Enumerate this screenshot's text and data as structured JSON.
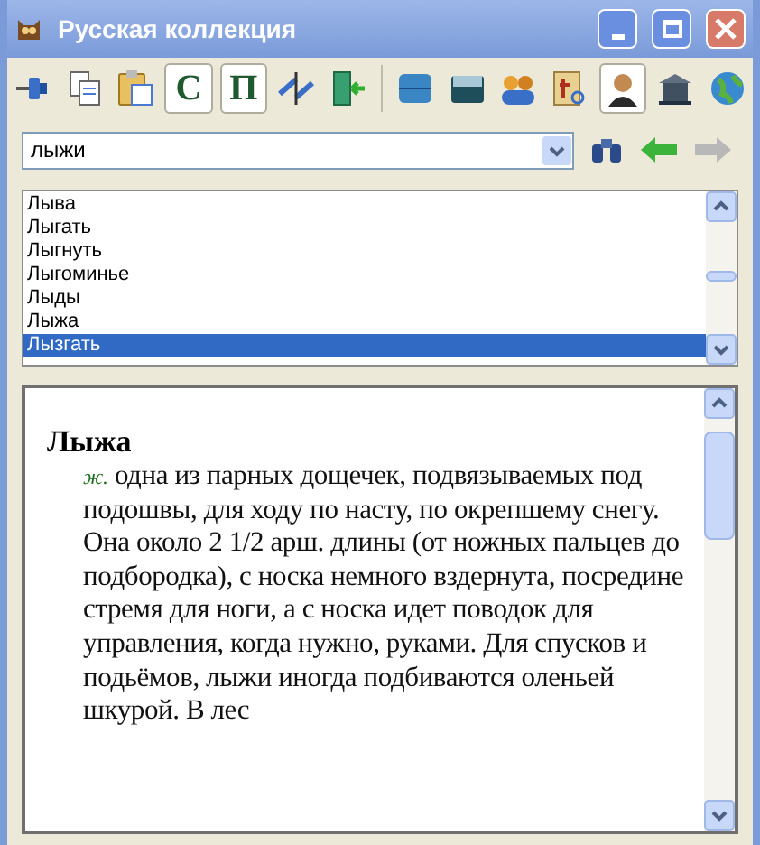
{
  "window": {
    "title": "Русская коллекция"
  },
  "toolbar": [
    {
      "kind": "pin",
      "pressed": false
    },
    {
      "kind": "copy",
      "pressed": false
    },
    {
      "kind": "paste",
      "pressed": false
    },
    {
      "kind": "letter",
      "label": "С",
      "pressed": true
    },
    {
      "kind": "letter",
      "label": "П",
      "pressed": true
    },
    {
      "kind": "swap",
      "pressed": false
    },
    {
      "kind": "exit",
      "pressed": false
    },
    {
      "kind": "separator"
    },
    {
      "kind": "book",
      "pressed": false
    },
    {
      "kind": "box",
      "pressed": false
    },
    {
      "kind": "people",
      "pressed": false
    },
    {
      "kind": "scroll",
      "pressed": false
    },
    {
      "kind": "portrait",
      "pressed": true
    },
    {
      "kind": "museum",
      "pressed": false
    },
    {
      "kind": "globe",
      "pressed": false
    }
  ],
  "search": {
    "value": "лыжи",
    "back_disabled": false,
    "forward_disabled": true
  },
  "word_list": [
    {
      "label": "Лыва",
      "selected": false
    },
    {
      "label": "Лыгать",
      "selected": false
    },
    {
      "label": "Лыгнуть",
      "selected": false
    },
    {
      "label": "Лыгоминье",
      "selected": false
    },
    {
      "label": "Лыды",
      "selected": false
    },
    {
      "label": "Лыжа",
      "selected": false
    },
    {
      "label": "Лызгать",
      "selected": true
    }
  ],
  "article": {
    "headword": "Лыжа",
    "grammar": "ж.",
    "definition": "одна из парных дощечек, подвязываемых под подошвы, для ходу по насту, по окрепшему снегу. Она около 2 1/2 арш. длины (от ножных пальцев до подбородка), с носка немного вздернута, посредине стремя для ноги, а с носка идет поводок для управления, когда нужно, руками. Для спусков и подьёмов, лыжи иногда подбиваются оленьей шкурой. В лес"
  }
}
